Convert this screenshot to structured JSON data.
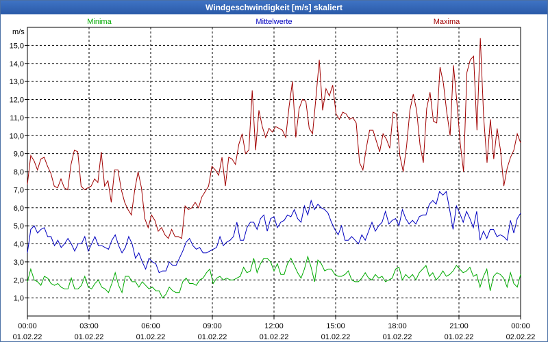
{
  "window": {
    "title": "Windgeschwindigkeit [m/s] skaliert"
  },
  "chart_data": {
    "type": "line",
    "title": "Windgeschwindigkeit [m/s] skaliert",
    "ylabel": "m/s",
    "ylim": [
      0,
      16
    ],
    "yticks": [
      "1,0",
      "2,0",
      "3,0",
      "4,0",
      "5,0",
      "6,0",
      "7,0",
      "8,0",
      "9,0",
      "10,0",
      "11,0",
      "12,0",
      "13,0",
      "14,0",
      "15,0"
    ],
    "xlim_hours": [
      0,
      24
    ],
    "xticks": [
      {
        "time": "00:00",
        "date": "01.02.22"
      },
      {
        "time": "03:00",
        "date": "01.02.22"
      },
      {
        "time": "06:00",
        "date": "01.02.22"
      },
      {
        "time": "09:00",
        "date": "01.02.22"
      },
      {
        "time": "12:00",
        "date": "01.02.22"
      },
      {
        "time": "15:00",
        "date": "01.02.22"
      },
      {
        "time": "18:00",
        "date": "01.02.22"
      },
      {
        "time": "21:00",
        "date": "01.02.22"
      },
      {
        "time": "00:00",
        "date": "02.02.22"
      }
    ],
    "grid": true,
    "legend": "top",
    "sample_interval_hours": 0.1667,
    "series": [
      {
        "name": "Minima",
        "color": "#00aa00",
        "values": [
          1.9,
          2.6,
          2.0,
          1.9,
          1.7,
          2.2,
          2.1,
          1.8,
          1.7,
          1.8,
          1.6,
          1.5,
          1.5,
          2.1,
          1.5,
          1.5,
          1.7,
          2.2,
          1.6,
          1.5,
          1.8,
          2.0,
          1.6,
          1.5,
          1.3,
          1.8,
          2.4,
          1.7,
          1.3,
          2.2,
          2.2,
          1.9,
          1.9,
          1.6,
          1.9,
          1.7,
          1.5,
          1.6,
          1.4,
          1.4,
          1.0,
          1.2,
          1.6,
          1.4,
          1.3,
          1.3,
          1.9,
          2.1,
          1.8,
          1.8,
          1.7,
          2.0,
          2.1,
          2.4,
          2.6,
          1.8,
          2.1,
          2.2,
          2.0,
          2.1,
          2.0,
          2.0,
          2.1,
          2.2,
          2.7,
          2.4,
          2.5,
          3.2,
          2.4,
          2.9,
          3.2,
          3.2,
          3.0,
          2.5,
          2.9,
          2.3,
          2.3,
          2.9,
          3.2,
          2.8,
          2.4,
          2.1,
          2.6,
          3.3,
          2.7,
          1.9,
          3.1,
          2.9,
          2.5,
          2.6,
          2.6,
          2.3,
          2.2,
          2.2,
          2.3,
          2.5,
          2.0,
          1.9,
          1.9,
          2.1,
          2.4,
          2.1,
          2.0,
          2.3,
          2.1,
          2.2,
          1.9,
          2.0,
          2.1,
          2.6,
          2.7,
          2.0,
          2.3,
          2.1,
          2.3,
          2.0,
          2.4,
          2.6,
          2.8,
          2.2,
          2.4,
          2.0,
          2.2,
          2.5,
          2.2,
          2.3,
          2.5,
          2.8,
          2.6,
          2.4,
          2.5,
          2.7,
          2.2,
          2.3,
          1.6,
          2.2,
          2.6,
          1.4,
          2.2,
          2.4,
          2.3,
          2.1,
          1.6,
          2.4,
          1.8,
          1.6,
          2.3
        ]
      },
      {
        "name": "Mittelwerte",
        "color": "#0000c0",
        "values": [
          3.5,
          4.8,
          5.0,
          4.6,
          4.8,
          4.9,
          4.4,
          4.4,
          3.9,
          4.2,
          3.8,
          4.0,
          4.3,
          4.0,
          3.6,
          4.0,
          4.0,
          4.4,
          3.6,
          4.0,
          4.4,
          3.9,
          3.9,
          3.8,
          3.7,
          4.2,
          4.5,
          3.9,
          3.5,
          3.8,
          4.4,
          4.0,
          3.2,
          3.5,
          3.0,
          2.6,
          3.2,
          3.0,
          2.9,
          2.4,
          2.5,
          2.5,
          3.0,
          2.8,
          2.8,
          3.2,
          3.6,
          4.1,
          4.3,
          3.9,
          3.7,
          3.8,
          3.5,
          3.5,
          3.6,
          3.7,
          3.8,
          4.4,
          3.9,
          4.1,
          4.2,
          4.4,
          5.2,
          4.2,
          4.2,
          4.9,
          5.2,
          5.2,
          4.8,
          5.4,
          5.6,
          4.7,
          5.4,
          5.5,
          4.9,
          5.2,
          5.3,
          5.6,
          5.5,
          5.9,
          5.4,
          5.2,
          6.1,
          5.6,
          6.4,
          5.9,
          6.2,
          6.0,
          5.9,
          5.7,
          5.2,
          4.8,
          4.5,
          5.0,
          4.2,
          4.2,
          4.4,
          4.2,
          4.0,
          4.5,
          4.2,
          4.7,
          5.2,
          4.7,
          5.0,
          5.2,
          5.8,
          5.1,
          5.3,
          5.4,
          5.0,
          5.9,
          5.4,
          5.1,
          5.3,
          5.1,
          5.5,
          5.6,
          5.6,
          6.2,
          6.4,
          6.2,
          6.9,
          6.7,
          6.9,
          5.9,
          4.8,
          6.1,
          5.7,
          5.2,
          5.8,
          5.4,
          4.9,
          5.8,
          4.2,
          4.7,
          4.3,
          4.8,
          4.8,
          4.4,
          4.5,
          4.4,
          4.2,
          5.3,
          4.6,
          5.4,
          5.7
        ]
      },
      {
        "name": "Maxima",
        "color": "#a00000",
        "values": [
          7.3,
          8.9,
          8.6,
          8.1,
          8.7,
          8.8,
          8.3,
          7.9,
          7.2,
          7.1,
          7.6,
          7.1,
          7.0,
          8.4,
          9.2,
          9.1,
          7.2,
          7.0,
          7.1,
          7.2,
          7.6,
          7.4,
          9.1,
          7.2,
          7.5,
          6.3,
          8.1,
          8.1,
          7.0,
          6.3,
          5.9,
          5.6,
          7.0,
          8.0,
          7.1,
          5.4,
          4.9,
          5.6,
          5.3,
          4.7,
          4.9,
          4.5,
          4.3,
          4.8,
          4.4,
          4.4,
          4.3,
          6.1,
          5.9,
          6.0,
          6.3,
          6.0,
          6.6,
          6.9,
          7.2,
          8.3,
          8.1,
          7.8,
          8.8,
          7.2,
          8.8,
          8.7,
          8.4,
          9.5,
          10.1,
          9.0,
          9.2,
          12.5,
          9.2,
          11.4,
          10.5,
          9.9,
          10.4,
          10.2,
          10.5,
          10.4,
          10.3,
          9.9,
          11.6,
          13.0,
          9.9,
          11.5,
          12.0,
          11.9,
          10.4,
          10.1,
          12.1,
          14.2,
          11.4,
          12.6,
          12.2,
          12.8,
          11.2,
          10.9,
          11.3,
          11.2,
          10.9,
          11.0,
          10.7,
          8.5,
          8.1,
          9.3,
          10.3,
          10.3,
          9.7,
          9.1,
          10.1,
          9.8,
          9.3,
          11.3,
          11.2,
          8.9,
          8.0,
          9.4,
          11.4,
          12.3,
          11.4,
          9.5,
          8.5,
          11.5,
          12.4,
          10.8,
          10.7,
          13.8,
          12.9,
          11.3,
          10.0,
          13.9,
          11.9,
          9.6,
          8.0,
          13.5,
          14.2,
          14.4,
          10.3,
          15.4,
          11.0,
          8.5,
          10.9,
          8.7,
          10.4,
          9.2,
          7.2,
          8.2,
          8.8,
          9.2,
          10.1,
          9.6
        ]
      }
    ]
  }
}
